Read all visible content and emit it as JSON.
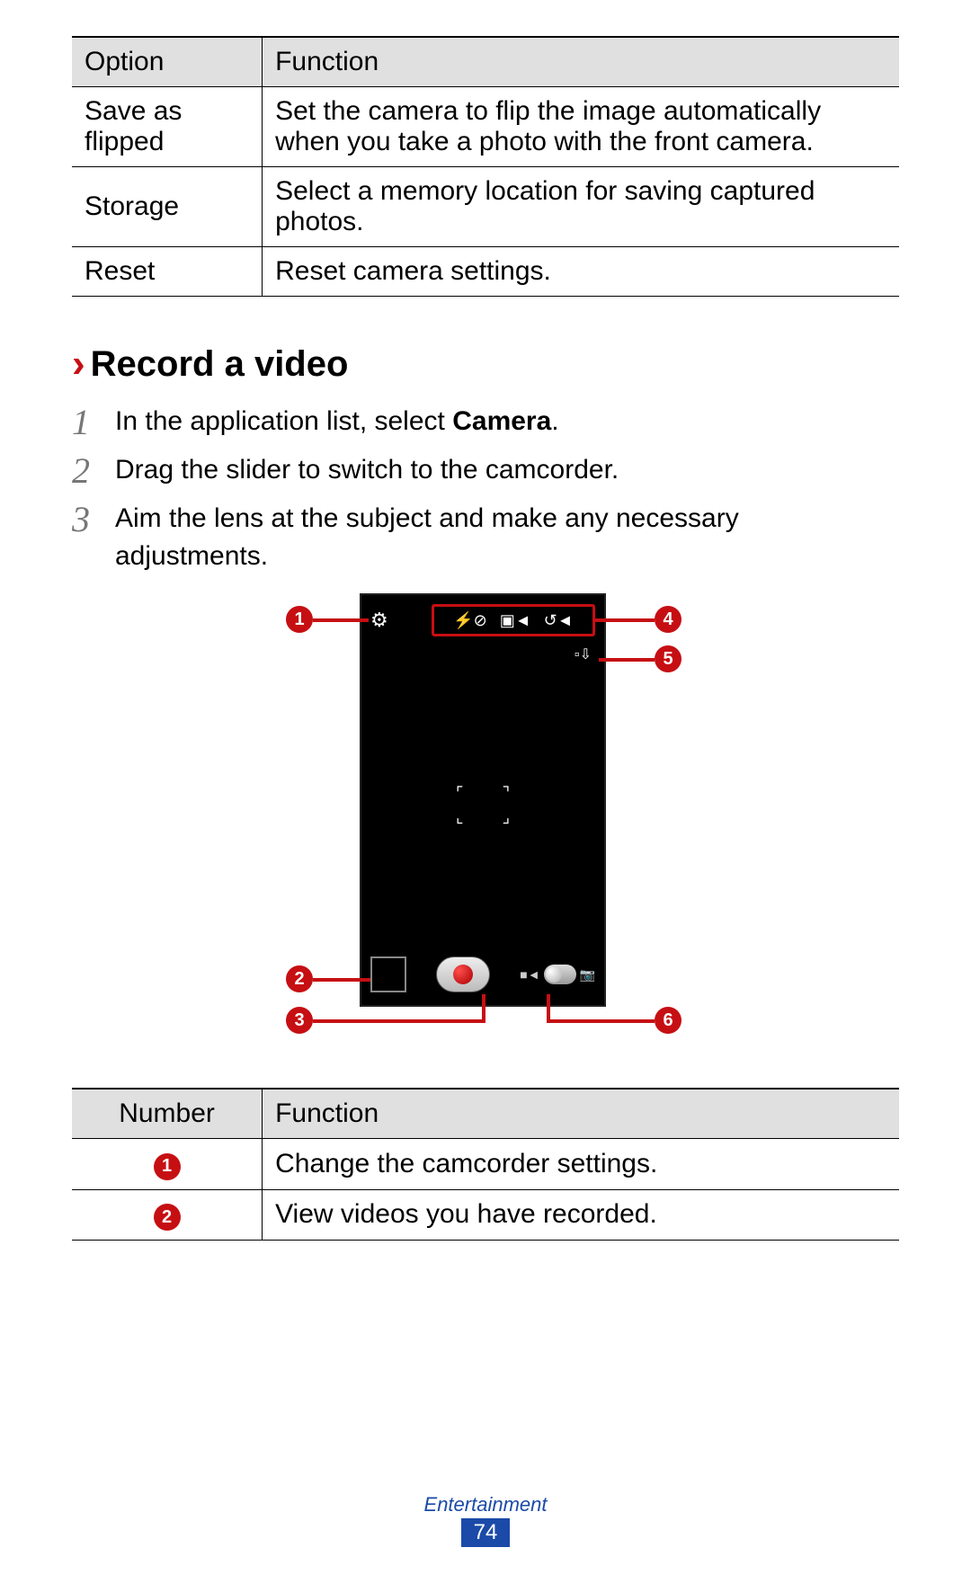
{
  "table1": {
    "headers": {
      "c1": "Option",
      "c2": "Function"
    },
    "rows": [
      {
        "c1": "Save as flipped",
        "c2": "Set the camera to flip the image automatically when you take a photo with the front camera."
      },
      {
        "c1": "Storage",
        "c2": "Select a memory location for saving captured photos."
      },
      {
        "c1": "Reset",
        "c2": "Reset camera settings."
      }
    ]
  },
  "section": {
    "chevron": "›",
    "title": "Record a video"
  },
  "steps": [
    {
      "num": "1",
      "pre": "In the application list, select ",
      "bold": "Camera",
      "post": "."
    },
    {
      "num": "2",
      "pre": "Drag the slider to switch to the camcorder.",
      "bold": "",
      "post": ""
    },
    {
      "num": "3",
      "pre": "Aim the lens at the subject and make any necessary adjustments.",
      "bold": "",
      "post": ""
    }
  ],
  "callouts": {
    "n1": "1",
    "n2": "2",
    "n3": "3",
    "n4": "4",
    "n5": "5",
    "n6": "6"
  },
  "table2": {
    "headers": {
      "c1": "Number",
      "c2": "Function"
    },
    "rows": [
      {
        "c1": "1",
        "c2": "Change the camcorder settings."
      },
      {
        "c1": "2",
        "c2": "View videos you have recorded."
      }
    ]
  },
  "footer": {
    "category": "Entertainment",
    "page": "74"
  }
}
